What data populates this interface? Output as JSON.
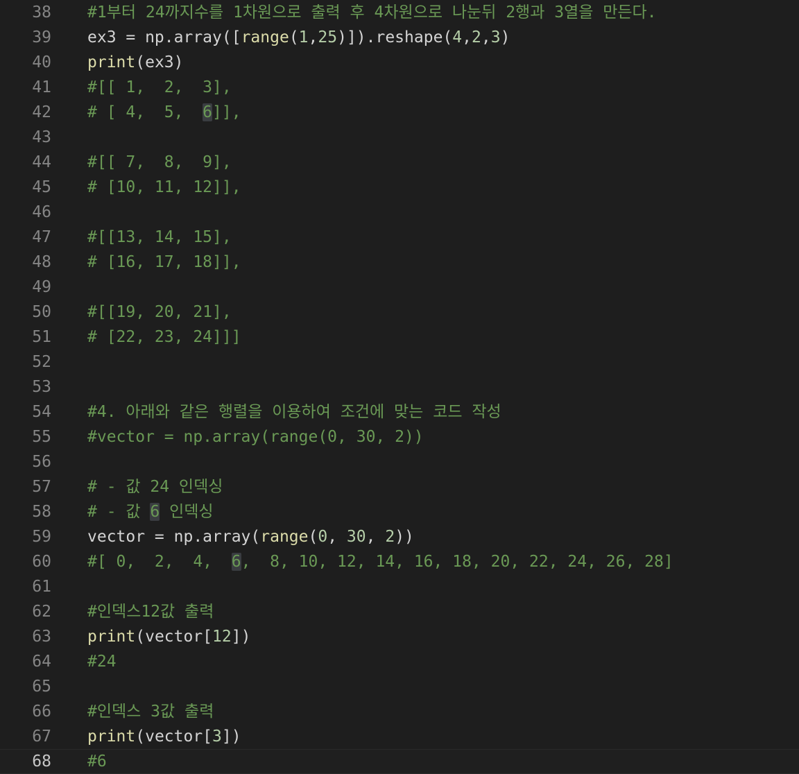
{
  "editor": {
    "lines": [
      {
        "num": "38",
        "parts": [
          {
            "t": "cm",
            "v": "#1부터 24까지수를 1차원으로 출력 후 4차원으로 나눈뒤 2행과 3열을 만든다."
          }
        ]
      },
      {
        "num": "39",
        "parts": [
          {
            "t": "tx",
            "v": "ex3 = np.array(["
          },
          {
            "t": "fn",
            "v": "range"
          },
          {
            "t": "tx",
            "v": "("
          },
          {
            "t": "nm",
            "v": "1"
          },
          {
            "t": "tx",
            "v": ","
          },
          {
            "t": "nm",
            "v": "25"
          },
          {
            "t": "tx",
            "v": ")]).reshape("
          },
          {
            "t": "nm",
            "v": "4"
          },
          {
            "t": "tx",
            "v": ","
          },
          {
            "t": "nm",
            "v": "2"
          },
          {
            "t": "tx",
            "v": ","
          },
          {
            "t": "nm",
            "v": "3"
          },
          {
            "t": "tx",
            "v": ")"
          }
        ]
      },
      {
        "num": "40",
        "parts": [
          {
            "t": "fn",
            "v": "print"
          },
          {
            "t": "tx",
            "v": "(ex3)"
          }
        ]
      },
      {
        "num": "41",
        "parts": [
          {
            "t": "cm",
            "v": "#[[ 1,  2,  3],"
          }
        ]
      },
      {
        "num": "42",
        "parts": [
          {
            "t": "cm",
            "v": "# [ 4,  5,  "
          },
          {
            "t": "cm hl",
            "v": "6"
          },
          {
            "t": "cm",
            "v": "]],"
          }
        ]
      },
      {
        "num": "43",
        "parts": []
      },
      {
        "num": "44",
        "parts": [
          {
            "t": "cm",
            "v": "#[[ 7,  8,  9],"
          }
        ]
      },
      {
        "num": "45",
        "parts": [
          {
            "t": "cm",
            "v": "# [10, 11, 12]],"
          }
        ]
      },
      {
        "num": "46",
        "parts": []
      },
      {
        "num": "47",
        "parts": [
          {
            "t": "cm",
            "v": "#[[13, 14, 15],"
          }
        ]
      },
      {
        "num": "48",
        "parts": [
          {
            "t": "cm",
            "v": "# [16, 17, 18]],"
          }
        ]
      },
      {
        "num": "49",
        "parts": []
      },
      {
        "num": "50",
        "parts": [
          {
            "t": "cm",
            "v": "#[[19, 20, 21],"
          }
        ]
      },
      {
        "num": "51",
        "parts": [
          {
            "t": "cm",
            "v": "# [22, 23, 24]]]"
          }
        ]
      },
      {
        "num": "52",
        "parts": []
      },
      {
        "num": "53",
        "parts": []
      },
      {
        "num": "54",
        "parts": [
          {
            "t": "cm",
            "v": "#4. 아래와 같은 행렬을 이용하여 조건에 맞는 코드 작성"
          }
        ]
      },
      {
        "num": "55",
        "parts": [
          {
            "t": "cm",
            "v": "#vector = np.array(range(0, 30, 2))"
          }
        ]
      },
      {
        "num": "56",
        "parts": []
      },
      {
        "num": "57",
        "parts": [
          {
            "t": "cm",
            "v": "# - 값 24 인덱싱"
          }
        ]
      },
      {
        "num": "58",
        "parts": [
          {
            "t": "cm",
            "v": "# - 값 "
          },
          {
            "t": "cm hl",
            "v": "6"
          },
          {
            "t": "cm",
            "v": " 인덱싱"
          }
        ]
      },
      {
        "num": "59",
        "parts": [
          {
            "t": "tx",
            "v": "vector = np.array("
          },
          {
            "t": "fn",
            "v": "range"
          },
          {
            "t": "tx",
            "v": "("
          },
          {
            "t": "nm",
            "v": "0"
          },
          {
            "t": "tx",
            "v": ", "
          },
          {
            "t": "nm",
            "v": "30"
          },
          {
            "t": "tx",
            "v": ", "
          },
          {
            "t": "nm",
            "v": "2"
          },
          {
            "t": "tx",
            "v": "))"
          }
        ]
      },
      {
        "num": "60",
        "parts": [
          {
            "t": "cm",
            "v": "#[ 0,  2,  4,  "
          },
          {
            "t": "cm hl",
            "v": "6"
          },
          {
            "t": "cm",
            "v": ",  8, 10, 12, 14, 16, 18, 20, 22, 24, 26, 28]"
          }
        ]
      },
      {
        "num": "61",
        "parts": []
      },
      {
        "num": "62",
        "parts": [
          {
            "t": "cm",
            "v": "#인덱스12값 출력"
          }
        ]
      },
      {
        "num": "63",
        "parts": [
          {
            "t": "fn",
            "v": "print"
          },
          {
            "t": "tx",
            "v": "(vector["
          },
          {
            "t": "nm",
            "v": "12"
          },
          {
            "t": "tx",
            "v": "])"
          }
        ]
      },
      {
        "num": "64",
        "parts": [
          {
            "t": "cm",
            "v": "#24"
          }
        ]
      },
      {
        "num": "65",
        "parts": []
      },
      {
        "num": "66",
        "parts": [
          {
            "t": "cm",
            "v": "#인덱스 3값 출력"
          }
        ]
      },
      {
        "num": "67",
        "parts": [
          {
            "t": "fn",
            "v": "print"
          },
          {
            "t": "tx",
            "v": "(vector["
          },
          {
            "t": "nm",
            "v": "3"
          },
          {
            "t": "tx",
            "v": "])"
          }
        ]
      },
      {
        "num": "68",
        "current": true,
        "parts": [
          {
            "t": "cm",
            "v": "#6"
          }
        ]
      }
    ]
  },
  "colors": {
    "background": "#1e1e1e",
    "comment": "#6a9955",
    "function": "#dcdcaa",
    "text": "#d4d4d4",
    "number": "#b5cea8",
    "line_number": "#858585",
    "highlight": "#3a3d41"
  }
}
